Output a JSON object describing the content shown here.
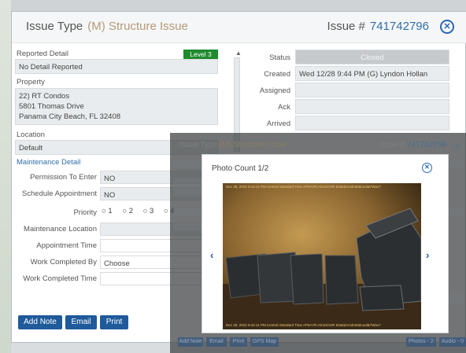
{
  "header": {
    "title": "Issue Type",
    "type_code": "(M) Structure Issue",
    "issue_label": "Issue #",
    "issue_number": "741742796"
  },
  "left": {
    "reported_detail_label": "Reported Detail",
    "level_badge": "Level 3",
    "reported_detail_value": "No Detail Reported",
    "property_label": "Property",
    "property_lines": [
      "22) RT Condos",
      "5801 Thomas Drive",
      "Panama City Beach, FL 32408"
    ],
    "location_label": "Location",
    "location_value": "Default",
    "maintenance_link": "Maintenance Detail",
    "permission_label": "Permission To Enter",
    "permission_value": "NO",
    "schedule_label": "Schedule Appointment",
    "schedule_value": "NO",
    "priority_label": "Priority",
    "priority_options": [
      "1",
      "2",
      "3",
      "4"
    ],
    "maint_location_label": "Maintenance Location",
    "appt_time_label": "Appointment Time",
    "completed_by_label": "Work Completed By",
    "completed_by_value": "Choose",
    "completed_time_label": "Work Completed Time"
  },
  "right": {
    "status_label": "Status",
    "status_value": "Closed",
    "created_label": "Created",
    "created_value": "Wed 12/28  9:44 PM (G) Lyndon Hollan",
    "assigned_label": "Assigned",
    "ack_label": "Ack",
    "arrived_label": "Arrived"
  },
  "buttons": {
    "add_note": "Add Note",
    "email": "Email",
    "print": "Print"
  },
  "overlay_bg": {
    "title": "Issue Type",
    "type_code": "(M) Structure Issue",
    "issue_label": "Issue #",
    "issue_number": "741742796",
    "btn_add_note": "Add Note",
    "btn_email": "Email",
    "btn_print": "Print",
    "btn_gps": "GPS Map",
    "btn_photos": "Photos - 2",
    "btn_audio": "Audio - 0"
  },
  "photo_modal": {
    "title": "Photo Count 1/2",
    "caption_top": "Dec 28, 2022 9:44:11 PM Central Standard Time  AP5A7R.HX10/AHR 82a6dAGdmManual&7Wav7",
    "caption_bottom": "Dec 28, 2022 9:44:11 PM Central Standard Time  AP5A7R.HX10/AHR 82a6dAGdmManual&7Wav7"
  },
  "icons": {
    "close": "close-icon",
    "prev": "chevron-left-icon",
    "next": "chevron-right-icon"
  },
  "colors": {
    "accent_blue": "#2f6ea8",
    "level_green": "#1f8a2e",
    "button_blue": "#1f5a9a",
    "type_code": "#b59a78"
  }
}
